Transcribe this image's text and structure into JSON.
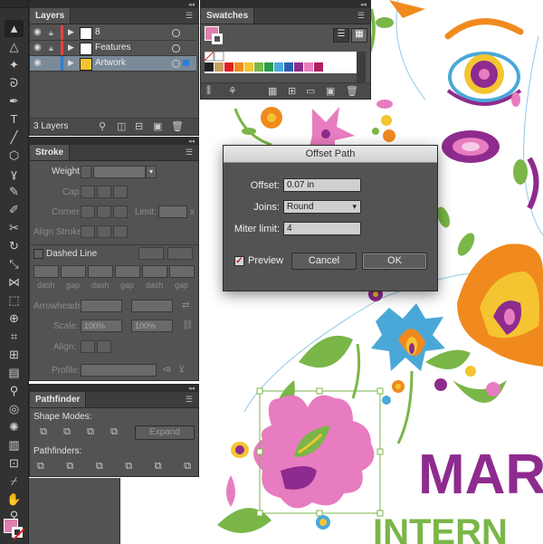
{
  "layers_panel": {
    "tab": "Layers",
    "rows": [
      {
        "name": "8",
        "color": "#e74040"
      },
      {
        "name": "Features",
        "color": "#e74040"
      },
      {
        "name": "Artwork",
        "color": "#2a7fd4"
      }
    ],
    "footer": "3 Layers"
  },
  "swatches_panel": {
    "tab": "Swatches",
    "current_fill": "#e07fb0"
  },
  "stroke_panel": {
    "tab": "Stroke",
    "weight_label": "Weight:",
    "cap_label": "Cap:",
    "corner_label": "Corner:",
    "limit_label": "Limit:",
    "limit_suffix": "x",
    "align_label": "Align Stroke:",
    "dashed_label": "Dashed Line",
    "dash_labels": [
      "dash",
      "gap",
      "dash",
      "gap",
      "dash",
      "gap"
    ],
    "arrowheads_label": "Arrowheads:",
    "scale_label": "Scale:",
    "scale_values": [
      "100%",
      "100%"
    ],
    "align_arrows_label": "Align:",
    "profile_label": "Profile:"
  },
  "pathfinder_panel": {
    "tab": "Pathfinder",
    "shape_modes_label": "Shape Modes:",
    "expand_label": "Expand",
    "pathfinders_label": "Pathfinders:"
  },
  "offset_path_dialog": {
    "title": "Offset Path",
    "offset_label": "Offset:",
    "offset_value": "0.07 in",
    "joins_label": "Joins:",
    "joins_value": "Round",
    "miter_label": "Miter limit:",
    "miter_value": "4",
    "preview_label": "Preview",
    "preview_checked": true,
    "cancel_label": "Cancel",
    "ok_label": "OK"
  },
  "artwork": {
    "text_line1": "MAR",
    "text_line2": "INTERN",
    "colors": {
      "purple": "#8e2b8e",
      "green": "#7ab648",
      "orange": "#f08a1e",
      "pink": "#e87cc0",
      "blue": "#4aa8d8",
      "yellow": "#f4c531"
    }
  }
}
